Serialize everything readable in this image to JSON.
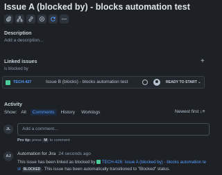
{
  "issue": {
    "title": "Issue A (blocked by) - blocks automation test"
  },
  "toolbar": {
    "buttons": [
      {
        "icon": "paperclip-icon"
      },
      {
        "icon": "child-issues-icon"
      },
      {
        "icon": "link-icon"
      },
      {
        "icon": "apps-icon"
      },
      {
        "icon": "automation-icon"
      },
      {
        "icon": "more-icon"
      }
    ]
  },
  "description": {
    "heading": "Description",
    "placeholder": "Add a description..."
  },
  "linked_issues": {
    "heading": "Linked issues",
    "add_icon": "+",
    "group_label": "is blocked by",
    "items": [
      {
        "key": "TECH-427",
        "summary": "Issue B (blocks) - blocks automation test",
        "status": "READY TO START",
        "status_caret": "⌄"
      }
    ]
  },
  "activity": {
    "heading": "Activity",
    "show_label": "Show:",
    "filters": [
      "All",
      "Comments",
      "History",
      "Worklogs"
    ],
    "active_filter": "Comments",
    "sort_label": "Newest first",
    "sort_icon": "↓≡",
    "comment": {
      "avatar_initials": "JL",
      "placeholder": "Add a comment...",
      "protip_label": "Pro tip:",
      "protip_pre": "press",
      "protip_key": "M",
      "protip_post": "to comment"
    },
    "entries": [
      {
        "avatar_initials": "AJ",
        "author": "Automation for Jira",
        "time": "24 seconds ago",
        "text_pre": "This issue has been linked as blocked by",
        "link_text": "TECH-426: Issue A (blocked by) - blocks automation te st",
        "status": "BLOCKED",
        "text_post": ". This issue has been automatically transitioned to \"Blocked\" status."
      }
    ]
  },
  "colors": {
    "background": "#1d2125",
    "link": "#579dff",
    "story": "#4bce97"
  }
}
